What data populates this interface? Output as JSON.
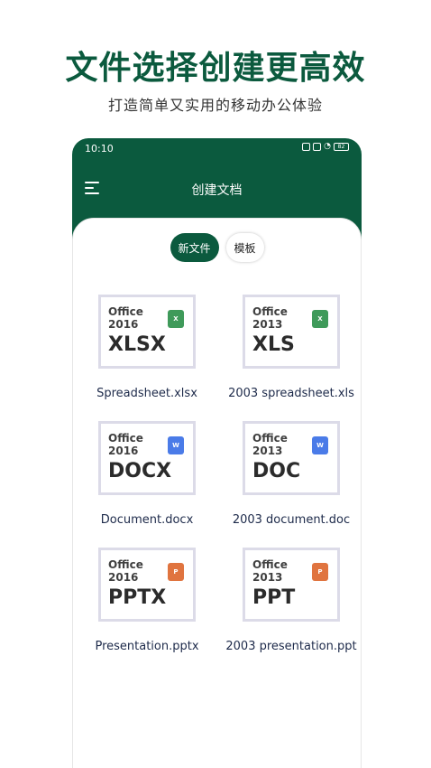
{
  "promo": {
    "headline": "文件选择创建更高效",
    "subline": "打造简单又实用的移动办公体验"
  },
  "status_bar": {
    "time": "10:10",
    "battery": "82"
  },
  "app_bar": {
    "title": "创建文档"
  },
  "tabs": [
    {
      "label": "新文件",
      "selected": true
    },
    {
      "label": "模板",
      "selected": false
    }
  ],
  "colors": {
    "primary": "#0b5a3e",
    "excel": "#3f9a5a",
    "word": "#4a7be8",
    "powerpoint": "#e0743f"
  },
  "files": [
    {
      "office": "Office",
      "version": "2016",
      "ext": "XLSX",
      "app": "X",
      "app_color": "#3f9a5a",
      "name": "Spreadsheet.xlsx"
    },
    {
      "office": "Office",
      "version": "2013",
      "ext": "XLS",
      "app": "X",
      "app_color": "#3f9a5a",
      "name": "2003  spreadsheet.xls"
    },
    {
      "office": "Office",
      "version": "2016",
      "ext": "DOCX",
      "app": "W",
      "app_color": "#4a7be8",
      "name": "Document.docx"
    },
    {
      "office": "Office",
      "version": "2013",
      "ext": "DOC",
      "app": "W",
      "app_color": "#4a7be8",
      "name": "2003  document.doc"
    },
    {
      "office": "Office",
      "version": "2016",
      "ext": "PPTX",
      "app": "P",
      "app_color": "#e0743f",
      "name": "Presentation.pptx"
    },
    {
      "office": "Office",
      "version": "2013",
      "ext": "PPT",
      "app": "P",
      "app_color": "#e0743f",
      "name": "2003  presentation.ppt"
    }
  ]
}
